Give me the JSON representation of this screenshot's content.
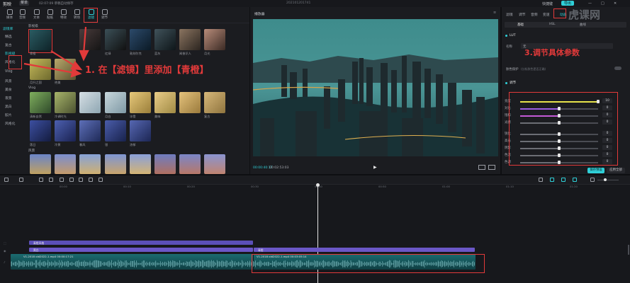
{
  "topbar": {
    "logo": "剪映",
    "menu_label": "菜单",
    "project_name": "02:07:09 草稿自动保存",
    "center_title": "202101201741",
    "shortcut_label": "快捷键",
    "export_label": "导出"
  },
  "toolbar": {
    "tools": [
      {
        "label": "媒体",
        "icon": "media-icon"
      },
      {
        "label": "音频",
        "icon": "audio-icon"
      },
      {
        "label": "文本",
        "icon": "text-icon"
      },
      {
        "label": "贴纸",
        "icon": "sticker-icon"
      },
      {
        "label": "特效",
        "icon": "effects-icon"
      },
      {
        "label": "转场",
        "icon": "transition-icon"
      },
      {
        "label": "滤镜",
        "icon": "filter-icon"
      },
      {
        "label": "调节",
        "icon": "adjust-icon"
      }
    ]
  },
  "categories": [
    "滤镜库",
    "精选",
    "复古",
    "影视级",
    "风格化",
    "Vlog",
    "风景",
    "美食",
    "夜景",
    "黑白",
    "胶片",
    "风格化"
  ],
  "sections": {
    "s1": "影视级",
    "s2": "Vlog",
    "s3": "风景"
  },
  "thumbs_row1": [
    "青橙",
    "红绿",
    "敦刻尔克",
    "蓝灰",
    "闻香识人",
    "月光"
  ],
  "thumbs_row2": [
    "月升之国",
    "绝美",
    "",
    "",
    "",
    ""
  ],
  "thumbs_row3": [
    "清新自然",
    "冷调时光",
    "月白",
    "冰雪",
    "美味",
    "复古"
  ],
  "thumbs_row4": [
    "落日",
    "冷黄",
    "春风",
    "银",
    "浓郁",
    ""
  ],
  "annotations": {
    "a1": "1.  在【滤镜】里添加【青橙】",
    "a3": "3.调节具体参数"
  },
  "preview": {
    "title": "播放器",
    "time_current": "00:00:40:17",
    "time_total": "00:02:53:03"
  },
  "right": {
    "tabs": [
      "滤镜",
      "调节",
      "音频",
      "变速",
      "动画"
    ],
    "subtabs": [
      "基础",
      "HSL",
      "曲线"
    ],
    "lut_label": "LUT",
    "name_label": "名称",
    "name_value": "无",
    "auto_label": "肤色保护",
    "auto_hint": "(分析肤色是否正确)",
    "adjust_label": "调节",
    "sliders": [
      {
        "label": "亮度",
        "value": "10",
        "fraction": 1.0,
        "color": "#e7e34b"
      },
      {
        "label": "对比",
        "value": "0",
        "fraction": 0.5,
        "color": "#9b5de5"
      },
      {
        "label": "饱和",
        "value": "0",
        "fraction": 0.5,
        "color": "#c45ad6"
      },
      {
        "label": "光感",
        "value": "0",
        "fraction": 0.5,
        "color": "#6c6e75"
      },
      {
        "label": "锐化",
        "value": "0",
        "fraction": 0.5,
        "color": "#6c6e75"
      },
      {
        "label": "高光",
        "value": "0",
        "fraction": 0.5,
        "color": "#6c6e75"
      },
      {
        "label": "阴影",
        "value": "0",
        "fraction": 0.5,
        "color": "#6c6e75"
      },
      {
        "label": "色温",
        "value": "0",
        "fraction": 0.5,
        "color": "#6c6e75"
      },
      {
        "label": "色调",
        "value": "0",
        "fraction": 0.5,
        "color": "#6c6e75"
      }
    ],
    "save_preset": "保存预设",
    "apply_all": "应用全部"
  },
  "timeline": {
    "ruler": [
      "00:00",
      "00:10",
      "00:20",
      "00:30",
      "00:40",
      "00:50",
      "01:00",
      "01:10",
      "01:20"
    ],
    "clip_fx": "青橙风格",
    "clip_a": "黑白",
    "clip_b": "青橙",
    "clip_video1": "V1-2018 old2022-1.mp4   00:00:17:21",
    "clip_video2": "V1-2018 old2022-1.mp4   00:03:05:14"
  },
  "colors": {
    "accent": "#2fd0d8",
    "red": "#e23a3a",
    "purple": "#6b57c7",
    "video": "#1d6f73"
  }
}
